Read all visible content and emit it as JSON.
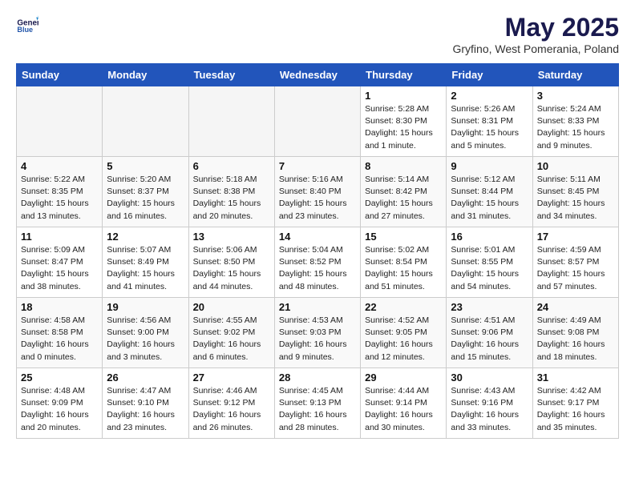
{
  "header": {
    "logo_general": "General",
    "logo_blue": "Blue",
    "month_title": "May 2025",
    "subtitle": "Gryfino, West Pomerania, Poland"
  },
  "days_of_week": [
    "Sunday",
    "Monday",
    "Tuesday",
    "Wednesday",
    "Thursday",
    "Friday",
    "Saturday"
  ],
  "weeks": [
    [
      {
        "day": "",
        "text": ""
      },
      {
        "day": "",
        "text": ""
      },
      {
        "day": "",
        "text": ""
      },
      {
        "day": "",
        "text": ""
      },
      {
        "day": "1",
        "text": "Sunrise: 5:28 AM\nSunset: 8:30 PM\nDaylight: 15 hours\nand 1 minute."
      },
      {
        "day": "2",
        "text": "Sunrise: 5:26 AM\nSunset: 8:31 PM\nDaylight: 15 hours\nand 5 minutes."
      },
      {
        "day": "3",
        "text": "Sunrise: 5:24 AM\nSunset: 8:33 PM\nDaylight: 15 hours\nand 9 minutes."
      }
    ],
    [
      {
        "day": "4",
        "text": "Sunrise: 5:22 AM\nSunset: 8:35 PM\nDaylight: 15 hours\nand 13 minutes."
      },
      {
        "day": "5",
        "text": "Sunrise: 5:20 AM\nSunset: 8:37 PM\nDaylight: 15 hours\nand 16 minutes."
      },
      {
        "day": "6",
        "text": "Sunrise: 5:18 AM\nSunset: 8:38 PM\nDaylight: 15 hours\nand 20 minutes."
      },
      {
        "day": "7",
        "text": "Sunrise: 5:16 AM\nSunset: 8:40 PM\nDaylight: 15 hours\nand 23 minutes."
      },
      {
        "day": "8",
        "text": "Sunrise: 5:14 AM\nSunset: 8:42 PM\nDaylight: 15 hours\nand 27 minutes."
      },
      {
        "day": "9",
        "text": "Sunrise: 5:12 AM\nSunset: 8:44 PM\nDaylight: 15 hours\nand 31 minutes."
      },
      {
        "day": "10",
        "text": "Sunrise: 5:11 AM\nSunset: 8:45 PM\nDaylight: 15 hours\nand 34 minutes."
      }
    ],
    [
      {
        "day": "11",
        "text": "Sunrise: 5:09 AM\nSunset: 8:47 PM\nDaylight: 15 hours\nand 38 minutes."
      },
      {
        "day": "12",
        "text": "Sunrise: 5:07 AM\nSunset: 8:49 PM\nDaylight: 15 hours\nand 41 minutes."
      },
      {
        "day": "13",
        "text": "Sunrise: 5:06 AM\nSunset: 8:50 PM\nDaylight: 15 hours\nand 44 minutes."
      },
      {
        "day": "14",
        "text": "Sunrise: 5:04 AM\nSunset: 8:52 PM\nDaylight: 15 hours\nand 48 minutes."
      },
      {
        "day": "15",
        "text": "Sunrise: 5:02 AM\nSunset: 8:54 PM\nDaylight: 15 hours\nand 51 minutes."
      },
      {
        "day": "16",
        "text": "Sunrise: 5:01 AM\nSunset: 8:55 PM\nDaylight: 15 hours\nand 54 minutes."
      },
      {
        "day": "17",
        "text": "Sunrise: 4:59 AM\nSunset: 8:57 PM\nDaylight: 15 hours\nand 57 minutes."
      }
    ],
    [
      {
        "day": "18",
        "text": "Sunrise: 4:58 AM\nSunset: 8:58 PM\nDaylight: 16 hours\nand 0 minutes."
      },
      {
        "day": "19",
        "text": "Sunrise: 4:56 AM\nSunset: 9:00 PM\nDaylight: 16 hours\nand 3 minutes."
      },
      {
        "day": "20",
        "text": "Sunrise: 4:55 AM\nSunset: 9:02 PM\nDaylight: 16 hours\nand 6 minutes."
      },
      {
        "day": "21",
        "text": "Sunrise: 4:53 AM\nSunset: 9:03 PM\nDaylight: 16 hours\nand 9 minutes."
      },
      {
        "day": "22",
        "text": "Sunrise: 4:52 AM\nSunset: 9:05 PM\nDaylight: 16 hours\nand 12 minutes."
      },
      {
        "day": "23",
        "text": "Sunrise: 4:51 AM\nSunset: 9:06 PM\nDaylight: 16 hours\nand 15 minutes."
      },
      {
        "day": "24",
        "text": "Sunrise: 4:49 AM\nSunset: 9:08 PM\nDaylight: 16 hours\nand 18 minutes."
      }
    ],
    [
      {
        "day": "25",
        "text": "Sunrise: 4:48 AM\nSunset: 9:09 PM\nDaylight: 16 hours\nand 20 minutes."
      },
      {
        "day": "26",
        "text": "Sunrise: 4:47 AM\nSunset: 9:10 PM\nDaylight: 16 hours\nand 23 minutes."
      },
      {
        "day": "27",
        "text": "Sunrise: 4:46 AM\nSunset: 9:12 PM\nDaylight: 16 hours\nand 26 minutes."
      },
      {
        "day": "28",
        "text": "Sunrise: 4:45 AM\nSunset: 9:13 PM\nDaylight: 16 hours\nand 28 minutes."
      },
      {
        "day": "29",
        "text": "Sunrise: 4:44 AM\nSunset: 9:14 PM\nDaylight: 16 hours\nand 30 minutes."
      },
      {
        "day": "30",
        "text": "Sunrise: 4:43 AM\nSunset: 9:16 PM\nDaylight: 16 hours\nand 33 minutes."
      },
      {
        "day": "31",
        "text": "Sunrise: 4:42 AM\nSunset: 9:17 PM\nDaylight: 16 hours\nand 35 minutes."
      }
    ]
  ]
}
